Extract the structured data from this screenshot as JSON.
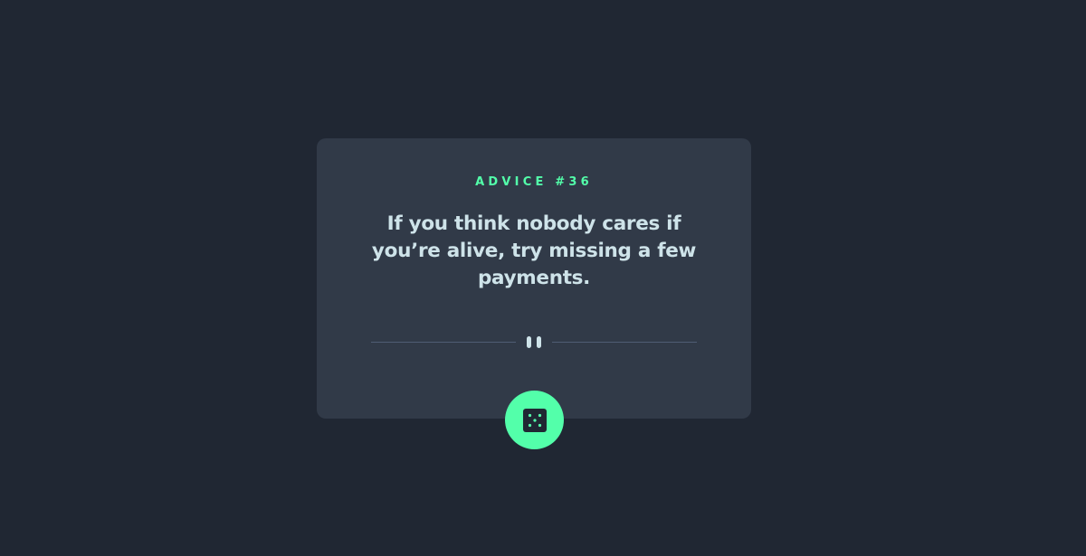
{
  "advice": {
    "id_label": "ADVICE #36",
    "text": "If you think nobody cares if you’re alive, try missing a few payments."
  },
  "colors": {
    "background": "#202733",
    "card": "#313a48",
    "accent": "#53ffaa",
    "text": "#cee3e9",
    "divider": "#4f5d74"
  },
  "icons": {
    "divider": "pause-icon",
    "button": "dice-icon"
  }
}
